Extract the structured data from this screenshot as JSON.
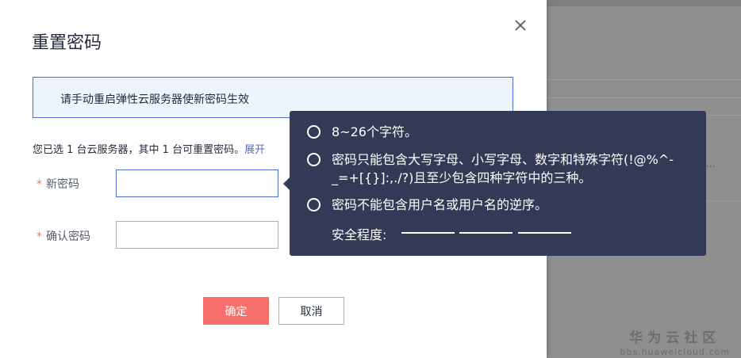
{
  "dialog": {
    "title": "重置密码",
    "notice": "请手动重启弹性云服务器使新密码生效",
    "info_text": "您已选 1 台云服务器，其中 1 台可重置密码。",
    "info_link": "展开",
    "new_password_label": "新密码",
    "confirm_password_label": "确认密码",
    "required_mark": "*",
    "ok_label": "确定",
    "cancel_label": "取消",
    "new_password_value": "",
    "confirm_password_value": ""
  },
  "tooltip": {
    "rules": [
      "8~26个字符。",
      "密码只能包含大写字母、小写字母、数字和特殊字符(!@%^-_=+[{}]:,./?)且至少包含四种字符中的三种。",
      "密码不能包含用户名或用户名的逆序。"
    ],
    "strength_label": "安全程度:"
  },
  "background": {
    "dots": "..."
  },
  "watermark": {
    "main": "华为云社区",
    "sub": "bbs.huaweicloud.com"
  },
  "colors": {
    "accent": "#526ecc",
    "primary_button": "#f66f6a",
    "tooltip_bg": "#333a55"
  }
}
